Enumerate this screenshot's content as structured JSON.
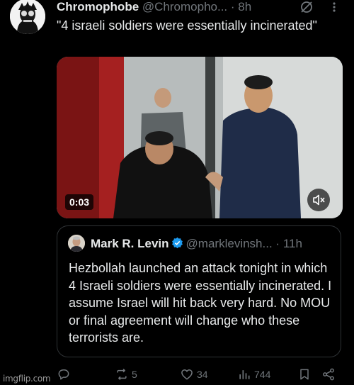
{
  "post": {
    "display_name": "Chromophobe",
    "handle": "@Chromopho...",
    "dot": "·",
    "time": "8h",
    "text": "\"4 israeli soldiers were essentially incinerated\""
  },
  "media": {
    "duration": "0:03",
    "volume_icon": "speaker-muted-icon"
  },
  "quoted_post": {
    "display_name": "Mark R. Levin",
    "handle": "@marklevinsh...",
    "dot": "·",
    "time": "11h",
    "verified": true,
    "text": "Hezbollah launched an attack tonight in which 4 Israeli soldiers were essentially incinerated.  I assume Israel will hit back very hard.  No MOU or final agreement will change who these terrorists are."
  },
  "actions": {
    "reply_count": "",
    "repost_count": "5",
    "like_count": "34",
    "view_count": "744"
  },
  "watermark": "imgflip.com",
  "colors": {
    "background": "#000000",
    "text": "#e7e9ea",
    "muted": "#71767b",
    "verified": "#1d9bf0",
    "border": "#2f3336"
  }
}
